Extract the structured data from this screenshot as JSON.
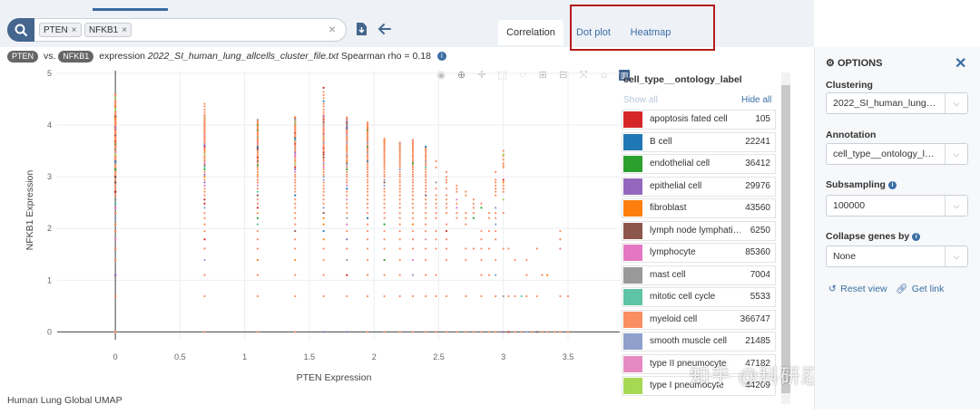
{
  "search": {
    "tags": [
      {
        "label": "PTEN"
      },
      {
        "label": "NFKB1"
      }
    ],
    "remove_glyph": "×",
    "clear_glyph": "×"
  },
  "tabs": [
    {
      "label": "Correlation",
      "active": true
    },
    {
      "label": "Dot plot",
      "active": false
    },
    {
      "label": "Heatmap",
      "active": false
    }
  ],
  "subtitle": {
    "gene_x": "PTEN",
    "vs": "vs.",
    "gene_y": "NFKB1",
    "expression_word": "expression",
    "file": "2022_SI_human_lung_allcells_cluster_file.txt",
    "stat_text": "Spearman rho = 0.18"
  },
  "chart_data": {
    "type": "scatter",
    "xlabel": "PTEN Expression",
    "ylabel": "NFKB1 Expression",
    "xlim": [
      -0.45,
      3.9
    ],
    "ylim": [
      -0.15,
      5.05
    ],
    "xticks": [
      0,
      0.5,
      1,
      1.5,
      2,
      2.5,
      3,
      3.5
    ],
    "xtick_labels": [
      "0",
      "0.5",
      "1",
      "1.5",
      "2",
      "2.5",
      "3",
      "3.5"
    ],
    "yticks": [
      0,
      1,
      2,
      3,
      4,
      5
    ],
    "ytick_labels": [
      "0",
      "1",
      "2",
      "3",
      "4",
      "5"
    ],
    "grid": true,
    "columns": [
      {
        "x": 0.0,
        "ymax": 4.6
      },
      {
        "x": 0.69,
        "ymax": 4.45
      },
      {
        "x": 1.1,
        "ymax": 4.1
      },
      {
        "x": 1.39,
        "ymax": 4.15
      },
      {
        "x": 1.61,
        "ymax": 4.72
      },
      {
        "x": 1.79,
        "ymax": 4.15
      },
      {
        "x": 1.95,
        "ymax": 4.05
      },
      {
        "x": 2.08,
        "ymax": 3.75
      },
      {
        "x": 2.2,
        "ymax": 3.68
      },
      {
        "x": 2.3,
        "ymax": 3.72
      },
      {
        "x": 2.4,
        "ymax": 3.6
      },
      {
        "x": 2.48,
        "ymax": 3.3
      },
      {
        "x": 2.56,
        "ymax": 3.1
      },
      {
        "x": 2.64,
        "ymax": 2.85
      },
      {
        "x": 2.71,
        "ymax": 2.75
      },
      {
        "x": 2.77,
        "ymax": 2.6
      },
      {
        "x": 2.83,
        "ymax": 2.5
      },
      {
        "x": 2.89,
        "ymax": 2.35
      },
      {
        "x": 2.94,
        "ymax": 3.1
      },
      {
        "x": 3.0,
        "ymax": 3.5
      },
      {
        "x": 3.04,
        "ymax": 1.7
      },
      {
        "x": 3.09,
        "ymax": 1.6
      },
      {
        "x": 3.14,
        "ymax": 1.35
      },
      {
        "x": 3.18,
        "ymax": 1.55
      },
      {
        "x": 3.22,
        "ymax": 1.2
      },
      {
        "x": 3.26,
        "ymax": 1.7
      },
      {
        "x": 3.3,
        "ymax": 1.1
      },
      {
        "x": 3.34,
        "ymax": 1.25
      },
      {
        "x": 3.4,
        "ymax": 1.05
      },
      {
        "x": 3.44,
        "ymax": 2.05
      },
      {
        "x": 3.5,
        "ymax": 1.0
      }
    ],
    "legend_title": "cell_type__ontology_label",
    "series": [
      {
        "name": "apoptosis fated cell",
        "count": "105",
        "color": "#d62728"
      },
      {
        "name": "B cell",
        "count": "22241",
        "color": "#1f77b4"
      },
      {
        "name": "endothelial cell",
        "count": "36412",
        "color": "#2ca02c"
      },
      {
        "name": "epithelial cell",
        "count": "29976",
        "color": "#9467bd"
      },
      {
        "name": "fibroblast",
        "count": "43560",
        "color": "#ff7f0e"
      },
      {
        "name": "lymph node lymphati…",
        "count": "6250",
        "color": "#8c564b"
      },
      {
        "name": "lymphocyte",
        "count": "85360",
        "color": "#e377c2"
      },
      {
        "name": "mast cell",
        "count": "7004",
        "color": "#999999"
      },
      {
        "name": "mitotic cell cycle",
        "count": "5533",
        "color": "#5ec4a4"
      },
      {
        "name": "myeloid cell",
        "count": "366747",
        "color": "#fa8e63"
      },
      {
        "name": "smooth muscle cell",
        "count": "21485",
        "color": "#8ea0cb"
      },
      {
        "name": "type II pneumocyte",
        "count": "47182",
        "color": "#e68ac3"
      },
      {
        "name": "type I pneumocyte",
        "count": "44209",
        "color": "#a6d854"
      }
    ]
  },
  "legend": {
    "title": "cell_type__ontology_label",
    "show_all": "Show all",
    "hide_all": "Hide all"
  },
  "options": {
    "title": "OPTIONS",
    "close_glyph": "✕",
    "clustering_label": "Clustering",
    "clustering_value": "2022_SI_human_lung…",
    "annotation_label": "Annotation",
    "annotation_value": "cell_type__ontology_l…",
    "subsampling_label": "Subsampling",
    "subsampling_value": "100000",
    "collapse_label": "Collapse genes by",
    "collapse_value": "None",
    "reset_view": "Reset view",
    "get_link": "Get link"
  },
  "footer_title": "Human Lung Global UMAP",
  "watermark": "知乎 @科研忍者老熊"
}
